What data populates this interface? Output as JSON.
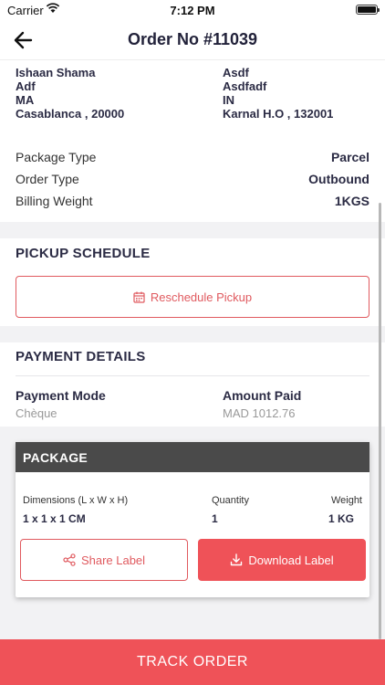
{
  "status_bar": {
    "carrier": "Carrier",
    "time": "7:12 PM"
  },
  "header": {
    "title": "Order No #11039"
  },
  "sender": {
    "name": "Ishaan Shama",
    "line1": "Adf",
    "line2": "MA",
    "city": "Casablanca , 20000"
  },
  "receiver": {
    "name": "Asdf",
    "line1": "Asdfadf",
    "line2": "IN",
    "city": "Karnal H.O , 132001"
  },
  "details": [
    {
      "label": "Package Type",
      "value": "Parcel"
    },
    {
      "label": "Order Type",
      "value": "Outbound"
    },
    {
      "label": "Billing Weight",
      "value": "1KGS"
    }
  ],
  "pickup": {
    "title": "PICKUP SCHEDULE",
    "button_label": "Reschedule Pickup"
  },
  "payment": {
    "title": "PAYMENT DETAILS",
    "mode_label": "Payment Mode",
    "mode_value": "Chèque",
    "amount_label": "Amount Paid",
    "amount_value": "MAD 1012.76"
  },
  "package": {
    "title": "PACKAGE",
    "dimensions_label": "Dimensions (L x W x H)",
    "dimensions_value": "1 x 1 x 1 CM",
    "quantity_label": "Quantity",
    "quantity_value": "1",
    "weight_label": "Weight",
    "weight_value": "1 KG",
    "share_label": "Share Label",
    "download_label": "Download Label"
  },
  "footer": {
    "track_label": "TRACK ORDER"
  },
  "colors": {
    "accent": "#ef5258",
    "text": "#2b2b44",
    "section_bg": "#f2f2f4",
    "card_header": "#4a4a4a"
  },
  "icons": [
    "wifi-icon",
    "battery-icon",
    "back-arrow-icon",
    "calendar-icon",
    "share-icon",
    "download-icon"
  ]
}
